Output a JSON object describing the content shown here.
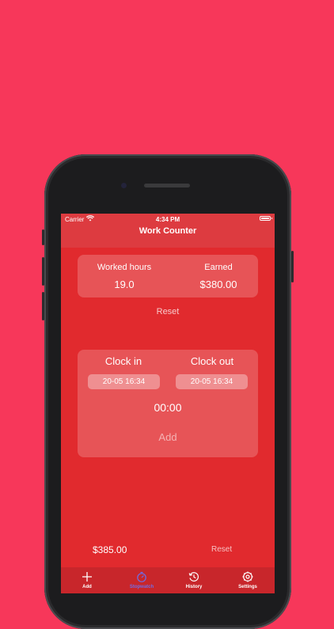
{
  "status": {
    "carrier": "Carrier",
    "time": "4:34 PM"
  },
  "nav": {
    "title": "Work Counter"
  },
  "summary": {
    "worked_label": "Worked hours",
    "worked_value": "19.0",
    "earned_label": "Earned",
    "earned_value": "$380.00",
    "reset_label": "Reset"
  },
  "clock": {
    "in_label": "Clock in",
    "out_label": "Clock out",
    "in_date": "20-05 16:34",
    "out_date": "20-05 16:34",
    "duration": "00:00",
    "add_label": "Add"
  },
  "footer": {
    "total": "$385.00",
    "reset_label": "Reset"
  },
  "tabs": [
    {
      "label": "Add",
      "icon": "plus-icon"
    },
    {
      "label": "Stopwatch",
      "icon": "stopwatch-icon"
    },
    {
      "label": "History",
      "icon": "history-icon"
    },
    {
      "label": "Settings",
      "icon": "gear-icon"
    }
  ],
  "colors": {
    "background": "#f7375a",
    "screen": "#e12a2e",
    "active_tab": "#6f6de6"
  }
}
